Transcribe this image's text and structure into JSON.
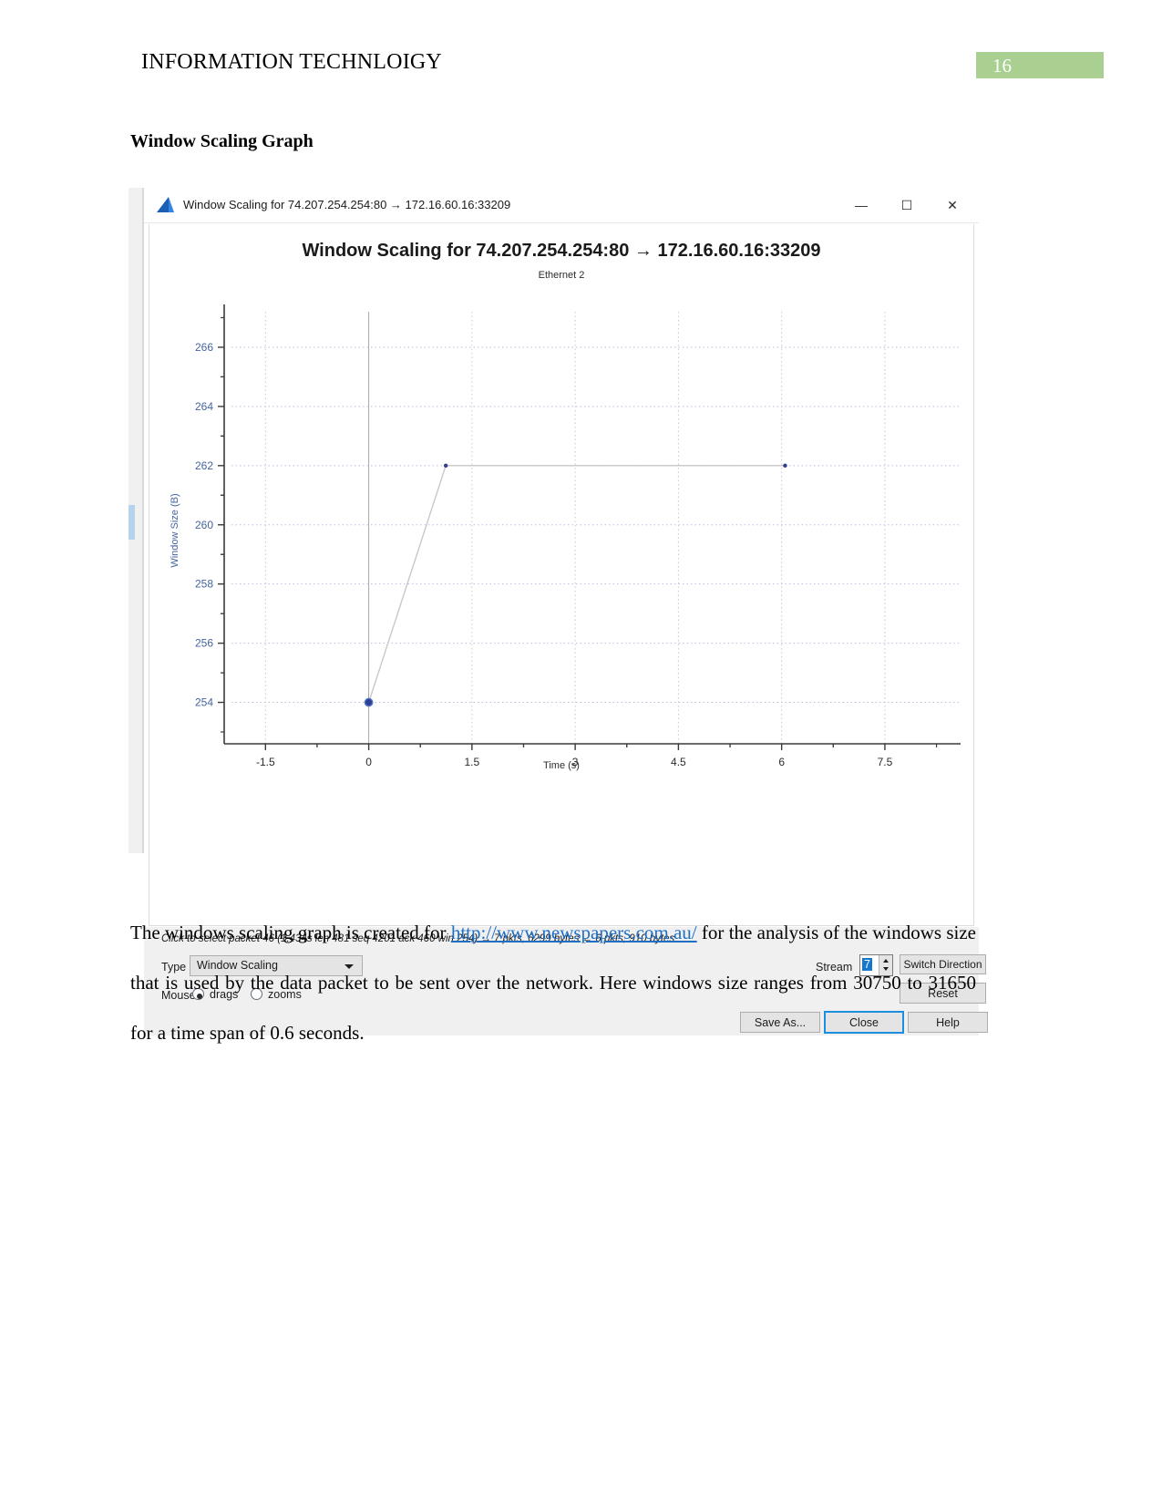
{
  "document": {
    "header_title": "INFORMATION TECHNLOIGY",
    "page_number": "16",
    "page_number_bg": "#a9cf91",
    "section_heading": "Window Scaling Graph",
    "paragraph_part1": "The windows scaling graph is created for ",
    "paragraph_link": "http://www.newspapers.com.au/",
    "paragraph_part2": "  for the analysis of the windows size that is used by the data packet to be sent over the network. Here windows size ranges from 30750 to 31650 for a time span of 0.6 seconds."
  },
  "window": {
    "titlebar_text": "Window Scaling for 74.207.254.254:80 → 172.16.60.16:33209",
    "app_icon": "wireshark-fin-icon",
    "minimize_glyph": "—",
    "maximize_glyph": "☐",
    "close_glyph": "✕"
  },
  "status": {
    "hint": "Click to select packet 46 (1.434s len 481 seq 4201 ack 460 win 254) → 7 pkts, 6299 bytes ← 6 pkts, 910 bytes"
  },
  "controls": {
    "type_label": "Type",
    "type_value": "Window Scaling",
    "type_options": [
      "Window Scaling"
    ],
    "mouse_label": "Mouse",
    "mouse_drags_label": "drags",
    "mouse_zooms_label": "zooms",
    "mouse_selected": "drags",
    "stream_label": "Stream",
    "stream_value": "7",
    "switch_direction_label": "Switch Direction",
    "reset_label": "Reset",
    "save_as_label": "Save As...",
    "close_label": "Close",
    "help_label": "Help"
  },
  "chart_data": {
    "type": "line",
    "title": "Window Scaling for 74.207.254.254:80 → 172.16.60.16:33209",
    "subtitle": "Ethernet 2",
    "xlabel": "Time (s)",
    "ylabel": "Window Size (B)",
    "xlim": [
      -2.1,
      8.6
    ],
    "ylim": [
      252.6,
      267.2
    ],
    "xticks": [
      "-1.5",
      "0",
      "1.5",
      "3",
      "4.5",
      "6",
      "7.5"
    ],
    "xtick_values": [
      -1.5,
      0,
      1.5,
      3,
      4.5,
      6,
      7.5
    ],
    "yticks": [
      "254",
      "256",
      "258",
      "260",
      "262",
      "264",
      "266"
    ],
    "ytick_values": [
      254,
      256,
      258,
      260,
      262,
      264,
      266
    ],
    "grid": true,
    "legend": "none",
    "series": [
      {
        "name": "Window Size",
        "color": "#2f3f8f",
        "line_color": "#c8c8c8",
        "x": [
          0,
          1.12,
          6.05
        ],
        "y": [
          254,
          262,
          262
        ]
      }
    ],
    "selected_point": {
      "x": 0,
      "y": 254
    }
  }
}
